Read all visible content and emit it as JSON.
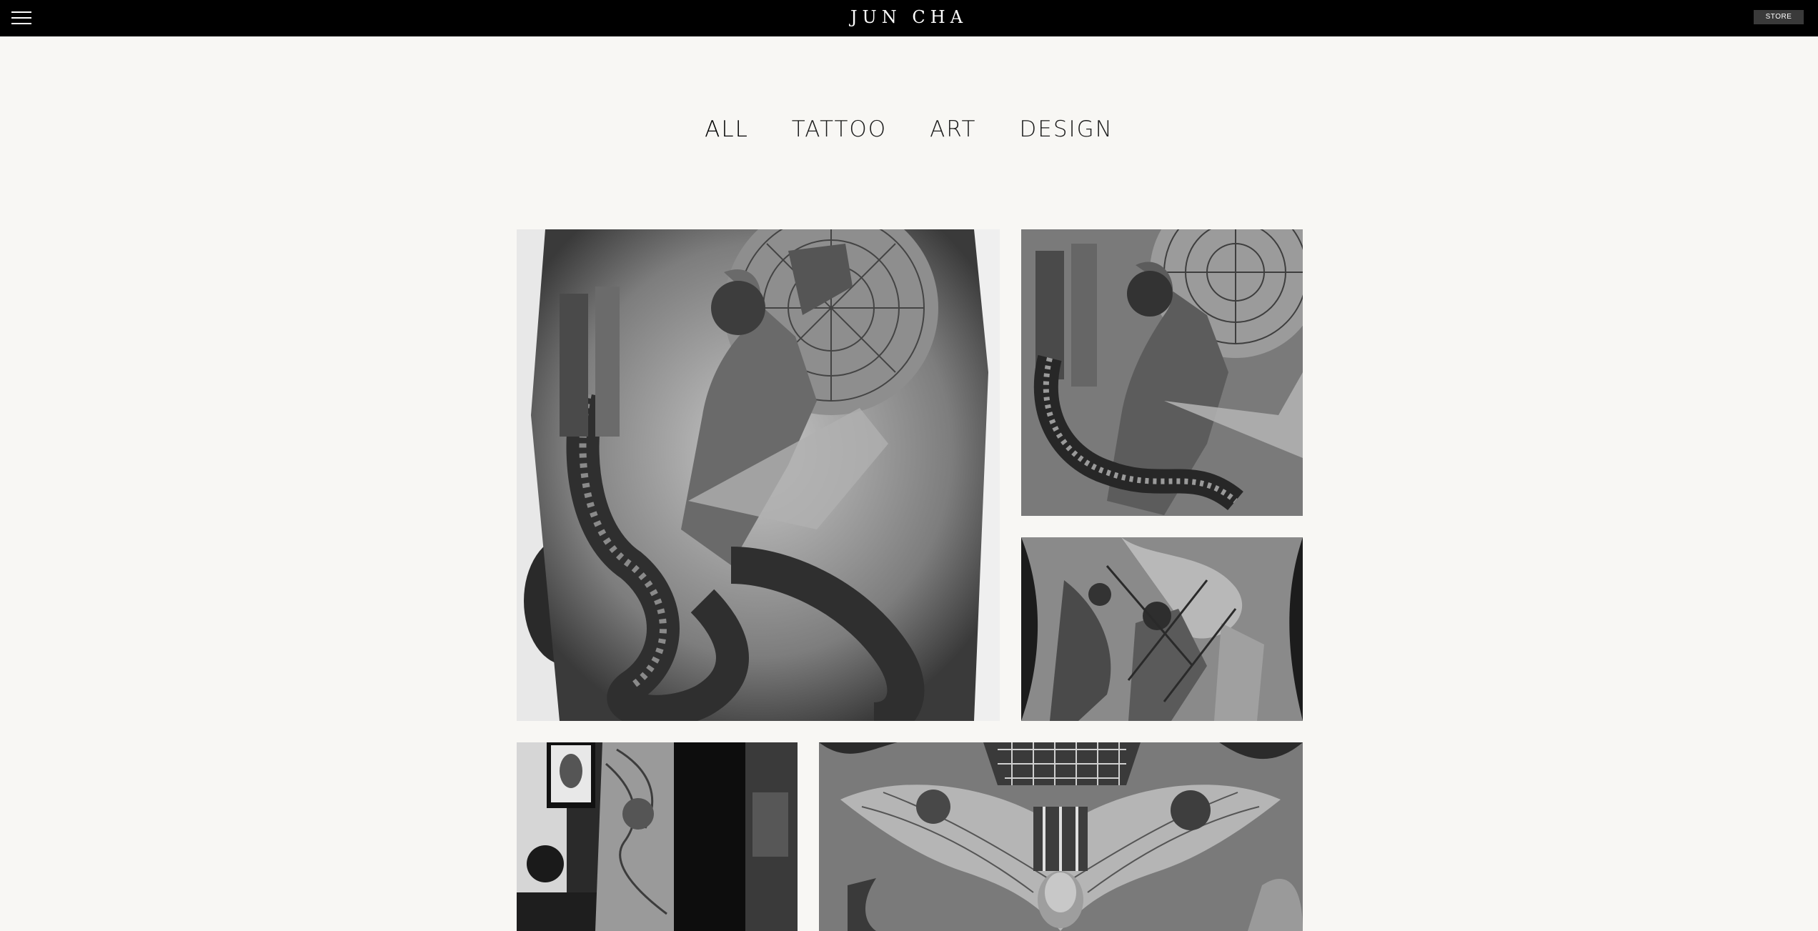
{
  "header": {
    "logo": "JUN CHA",
    "store_label": "STORE"
  },
  "filters": [
    "ALL",
    "TATTOO",
    "ART",
    "DESIGN"
  ],
  "active_filter": "ALL",
  "gallery": [
    {
      "name": "back-piece-snake-statue"
    },
    {
      "name": "back-piece-snake-statue-detail"
    },
    {
      "name": "back-piece-battle-scene"
    },
    {
      "name": "sleeve-portrait"
    },
    {
      "name": "chest-angel-wings"
    }
  ],
  "colors": {
    "topbar": "#000000",
    "background": "#f8f7f4",
    "store_button": "#3a3a3a"
  }
}
